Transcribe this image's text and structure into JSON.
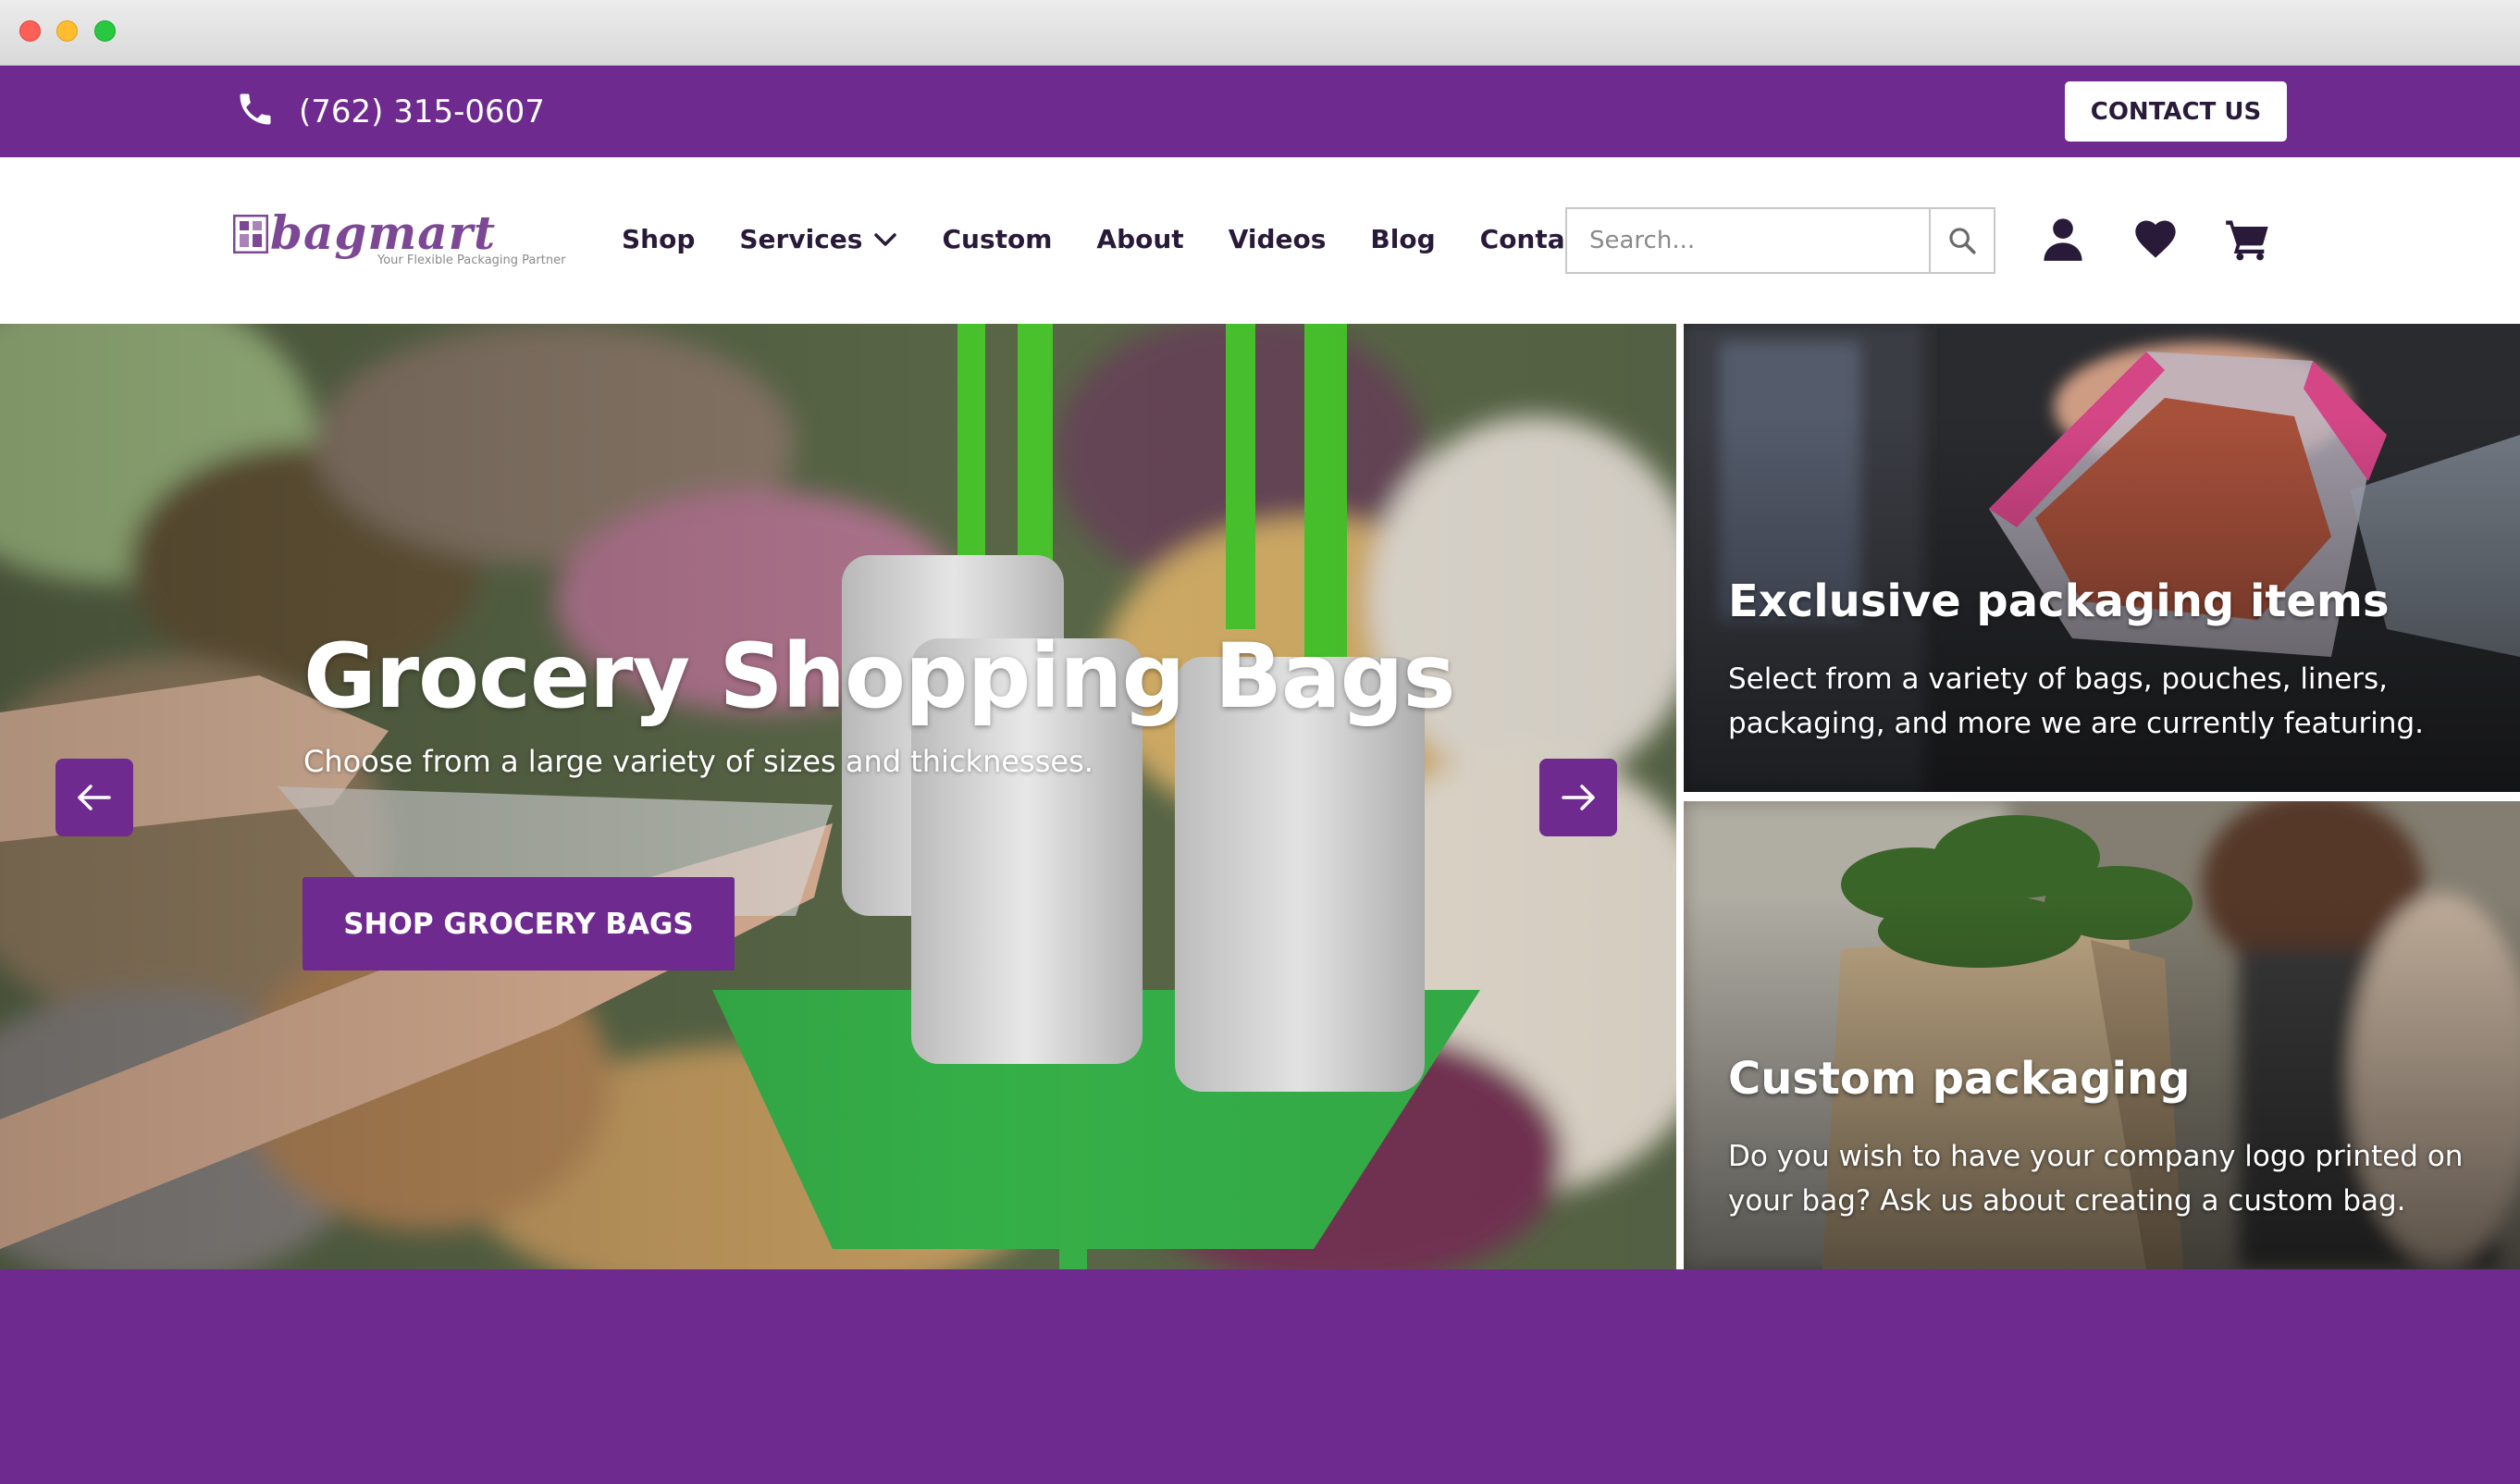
{
  "topbar": {
    "phone": "(762) 315-0607",
    "contact_label": "CONTACT US"
  },
  "brand": {
    "name": "bagmart",
    "tagline": "Your Flexible Packaging Partner",
    "purple": "#6e2a8e"
  },
  "nav": {
    "items": [
      {
        "label": "Shop"
      },
      {
        "label": "Services",
        "has_dropdown": true
      },
      {
        "label": "Custom"
      },
      {
        "label": "About"
      },
      {
        "label": "Videos"
      },
      {
        "label": "Blog"
      },
      {
        "label": "Contact"
      }
    ],
    "search_placeholder": "Search...",
    "icons": [
      "search-icon",
      "account-icon",
      "heart-icon",
      "cart-icon"
    ]
  },
  "hero": {
    "title": "Grocery Shopping Bags",
    "subtitle": "Choose from a large variety of sizes and thicknesses.",
    "button_label": "SHOP GROCERY BAGS"
  },
  "promos": [
    {
      "title": "Exclusive packaging items",
      "text": "Select from a variety of bags, pouches, liners, packaging, and more we are currently featuring."
    },
    {
      "title": "Custom packaging",
      "text": "Do you wish to have your company logo printed on your bag? Ask us about creating a custom bag."
    }
  ]
}
